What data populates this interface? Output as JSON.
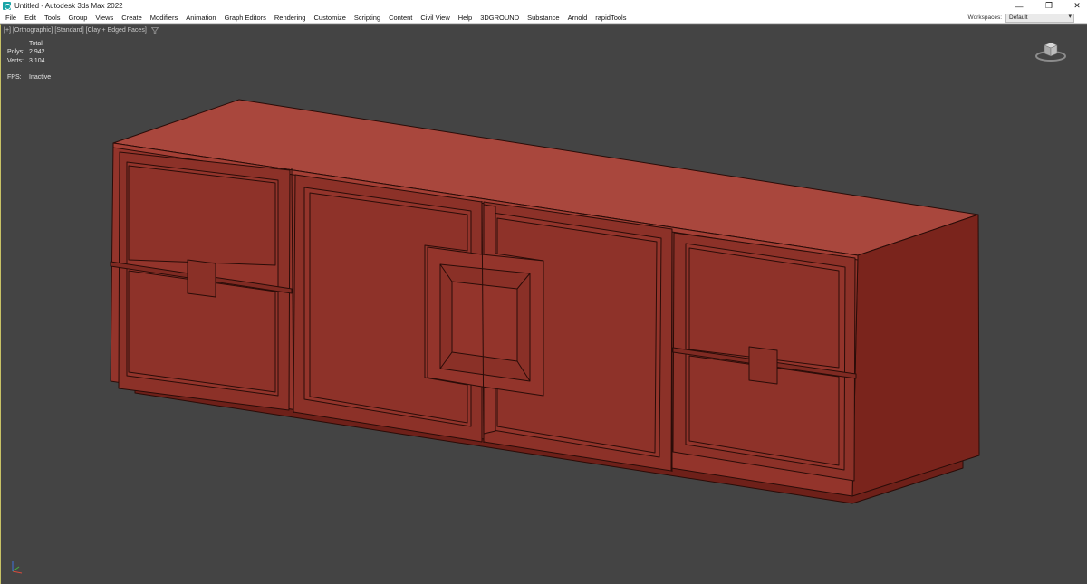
{
  "window": {
    "title": "Untitled - Autodesk 3ds Max 2022",
    "controls": {
      "minimize": "—",
      "restore": "❐",
      "close": "✕"
    }
  },
  "menu": {
    "items": [
      "File",
      "Edit",
      "Tools",
      "Group",
      "Views",
      "Create",
      "Modifiers",
      "Animation",
      "Graph Editors",
      "Rendering",
      "Customize",
      "Scripting",
      "Content",
      "Civil View",
      "Help",
      "3DGROUND",
      "Substance",
      "Arnold",
      "rapidTools"
    ],
    "workspaces_label": "Workspaces:",
    "workspaces_value": "Default"
  },
  "viewport": {
    "label": {
      "plus": "[+]",
      "view": "[Orthographic]",
      "shading": "[Standard]",
      "style": "[Clay + Edged Faces]"
    },
    "stats": {
      "total_label": "Total",
      "polys_label": "Polys:",
      "polys_value": "2 942",
      "verts_label": "Verts:",
      "verts_value": "3 104",
      "fps_label": "FPS:",
      "fps_value": "Inactive"
    },
    "icons": {
      "filter": "filter-icon",
      "viewcube": "viewcube-icon",
      "axis": "axis-tripod-icon"
    }
  },
  "colors": {
    "viewport_bg": "#444444",
    "model_top": "#a9473d",
    "model_front": "#93342b",
    "model_side": "#7a241c",
    "edge": "#2a0c08"
  }
}
